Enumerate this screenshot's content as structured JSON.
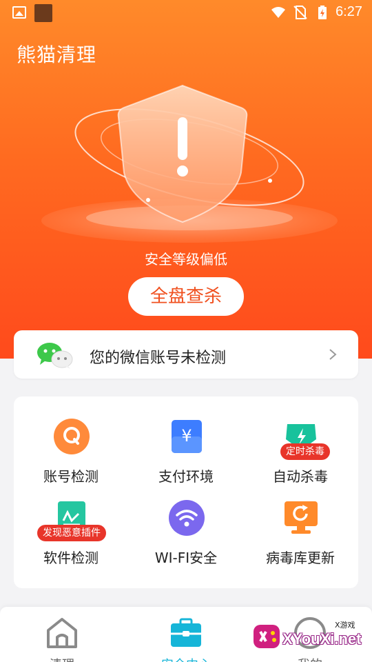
{
  "status_bar": {
    "time": "6:27",
    "icons": [
      "image-icon",
      "app-square-icon",
      "wifi-icon",
      "no-sim-icon",
      "battery-charging-icon"
    ]
  },
  "header": {
    "app_title": "熊猫清理"
  },
  "hero": {
    "level_text": "安全等级偏低",
    "scan_button_label": "全盘查杀",
    "shield_icon": "shield-alert-icon"
  },
  "wechat_card": {
    "icon": "wechat-icon",
    "text": "您的微信账号未检测"
  },
  "tools": [
    {
      "label": "账号检测",
      "icon": "account-check-icon",
      "color": "#ff8a3a",
      "badge": ""
    },
    {
      "label": "支付环境",
      "icon": "payment-yen-icon",
      "color": "#3d7dff",
      "badge": ""
    },
    {
      "label": "自动杀毒",
      "icon": "auto-antivirus-icon",
      "color": "#18c29c",
      "badge": "定时杀毒"
    },
    {
      "label": "软件检测",
      "icon": "software-check-icon",
      "color": "#25c6a0",
      "badge": "发现恶意插件"
    },
    {
      "label": "WI-FI安全",
      "icon": "wifi-security-icon",
      "color": "#7b68ee",
      "badge": ""
    },
    {
      "label": "病毒库更新",
      "icon": "virus-db-update-icon",
      "color": "#ff8a2a",
      "badge": ""
    }
  ],
  "bottom_nav": {
    "items": [
      {
        "label": "清理",
        "icon": "home-icon",
        "active": false
      },
      {
        "label": "安全中心",
        "icon": "toolbox-icon",
        "active": true
      },
      {
        "label": "我的",
        "icon": "profile-icon",
        "active": false
      }
    ]
  },
  "watermark": {
    "text": "XYouXi.net",
    "small": "X游戏"
  },
  "colors": {
    "hero_top": "#ff8a2a",
    "hero_bottom": "#ff4a1c",
    "accent_active": "#16b5d8",
    "badge_red": "#e8352a",
    "scan_text": "#f0501f"
  }
}
